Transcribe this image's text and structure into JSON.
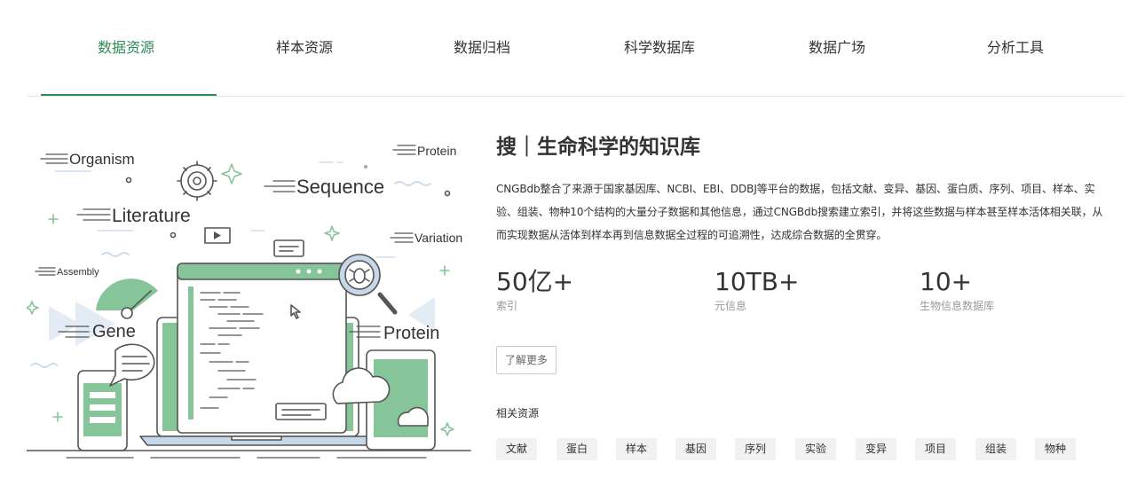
{
  "tabs": [
    {
      "label": "数据资源",
      "active": true
    },
    {
      "label": "样本资源",
      "active": false
    },
    {
      "label": "数据归档",
      "active": false
    },
    {
      "label": "科学数据库",
      "active": false
    },
    {
      "label": "数据广场",
      "active": false
    },
    {
      "label": "分析工具",
      "active": false
    }
  ],
  "illustration": {
    "labels": {
      "organism": "Organism",
      "protein_small": "Protein",
      "sequence": "Sequence",
      "literature": "Literature",
      "variation": "Variation",
      "assembly": "Assembly",
      "gene": "Gene",
      "protein_large": "Protein"
    }
  },
  "main": {
    "heading": "搜｜生命科学的知识库",
    "description": "CNGBdb整合了来源于国家基因库、NCBI、EBI、DDBJ等平台的数据，包括文献、变异、基因、蛋白质、序列、项目、样本、实验、组装、物种10个结构的大量分子数据和其他信息，通过CNGBdb搜索建立索引，并将这些数据与样本甚至样本活体相关联，从而实现数据从活体到样本再到信息数据全过程的可追溯性，达成综合数据的全贯穿。",
    "stats": [
      {
        "value": "50亿+",
        "label": "索引"
      },
      {
        "value": "10TB+",
        "label": "元信息"
      },
      {
        "value": "10+",
        "label": "生物信息数据库"
      }
    ],
    "more_label": "了解更多",
    "related_title": "相关资源",
    "related": [
      "文献",
      "蛋白",
      "样本",
      "基因",
      "序列",
      "实验",
      "变异",
      "项目",
      "组装",
      "物种"
    ]
  },
  "colors": {
    "accent": "#2e8b57",
    "illustration_green": "#86c59a",
    "illustration_line": "#555555",
    "illustration_blue": "#c7d7ea"
  }
}
